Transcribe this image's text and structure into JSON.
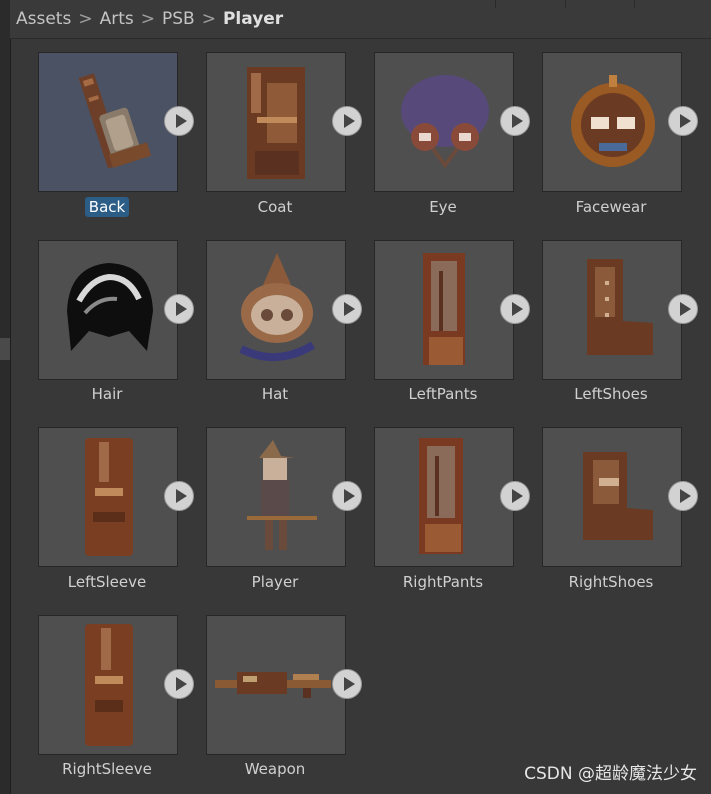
{
  "breadcrumb": {
    "items": [
      "Assets",
      "Arts",
      "PSB",
      "Player"
    ],
    "separator": ">"
  },
  "assets": [
    {
      "name": "Back",
      "selected": true,
      "icon": "back-sprite"
    },
    {
      "name": "Coat",
      "icon": "coat-sprite"
    },
    {
      "name": "Eye",
      "icon": "eye-sprite"
    },
    {
      "name": "Facewear",
      "icon": "facewear-sprite"
    },
    {
      "name": "Hair",
      "icon": "hair-sprite"
    },
    {
      "name": "Hat",
      "icon": "hat-sprite"
    },
    {
      "name": "LeftPants",
      "icon": "pants-sprite"
    },
    {
      "name": "LeftShoes",
      "icon": "shoes-sprite"
    },
    {
      "name": "LeftSleeve",
      "icon": "sleeve-sprite"
    },
    {
      "name": "Player",
      "icon": "player-sprite"
    },
    {
      "name": "RightPants",
      "icon": "pants-sprite"
    },
    {
      "name": "RightShoes",
      "icon": "shoes-sprite"
    },
    {
      "name": "RightSleeve",
      "icon": "sleeve-sprite"
    },
    {
      "name": "Weapon",
      "icon": "weapon-sprite"
    }
  ],
  "watermark": "CSDN @超龄魔法少女",
  "colors": {
    "background": "#383838",
    "tile": "#4f4f4f",
    "selection": "#2c5d87",
    "sprite_brown": "#7a4a2c"
  }
}
